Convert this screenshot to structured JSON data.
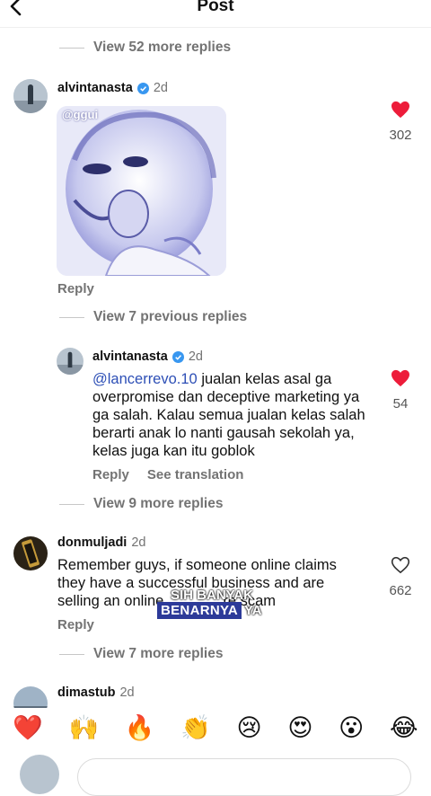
{
  "header": {
    "title": "Post"
  },
  "thread_top": {
    "view_more": "View 52 more replies"
  },
  "comment1": {
    "username": "alvintanasta",
    "time": "2d",
    "sticker_watermark": "@ggui",
    "reply": "Reply",
    "likes": "302",
    "previous_replies": "View 7 previous replies"
  },
  "reply1": {
    "username": "alvintanasta",
    "time": "2d",
    "mention": "@lancerrevo.10",
    "text": " jualan kelas asal ga overpromise dan deceptive marketing ya ga salah. Kalau semua jualan kelas salah berarti anak lo nanti gausah sekolah ya, kelas juga kan itu goblok",
    "reply": "Reply",
    "see_translation": "See translation",
    "likes": "54",
    "more_replies": "View 9 more replies"
  },
  "comment2": {
    "username": "donmuljadi",
    "time": "2d",
    "text_line1": "Remember guys, if someone online claims",
    "text_line2": "they have a successful business and are",
    "text_line3a": "selling an online",
    "text_line3b": "re scam",
    "reply": "Reply",
    "likes": "662",
    "more_replies": "View 7 more replies"
  },
  "video_caption": {
    "top": "SIH BANYAK",
    "bottom": "BENARNYA",
    "bottom_suffix": "YA"
  },
  "comment3": {
    "username": "dimastub",
    "time": "2d"
  },
  "emoji_bar": [
    "❤️",
    "🙌",
    "🔥",
    "👏",
    "😢",
    "😍",
    "😮",
    "😂"
  ],
  "colors": {
    "heart": "#ed1c3a",
    "verified": "#3897f0",
    "mention": "#2d4fb6",
    "caption_bg": "#2c3a99"
  }
}
